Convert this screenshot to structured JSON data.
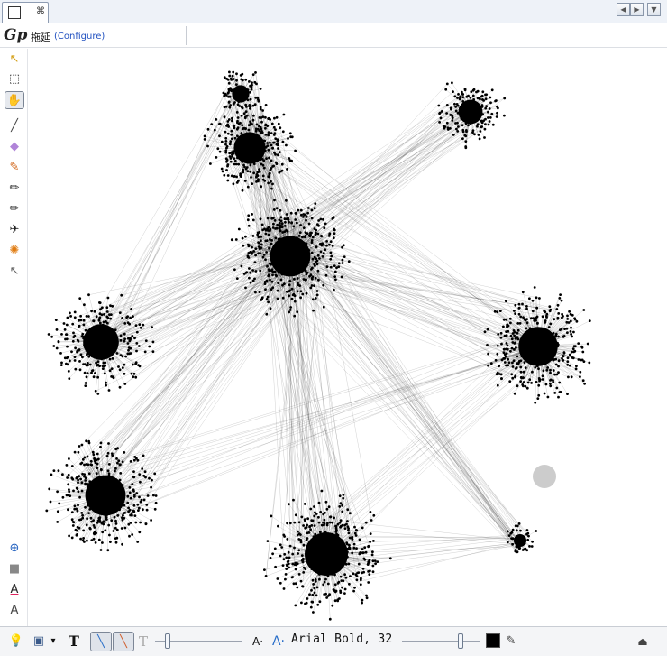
{
  "tab": {
    "close_glyph": "⌘"
  },
  "tab_nav": {
    "left": "◀",
    "right": "▶",
    "menu": "▼"
  },
  "context_bar": {
    "logo_text": "Gp",
    "tool_label": "拖延",
    "configure_link": "(Configure)"
  },
  "left_toolbar": [
    {
      "name": "pointer-icon",
      "glyph": "↖",
      "selected": false,
      "color": "#d4a017"
    },
    {
      "name": "rect-select-icon",
      "glyph": "⬚",
      "selected": false,
      "color": "#333333"
    },
    {
      "name": "drag-hand-icon",
      "glyph": "✋",
      "selected": true,
      "color": "#d4a017"
    },
    {
      "name": "brush-icon",
      "glyph": "╱",
      "selected": false,
      "color": "#444444"
    },
    {
      "name": "diamond-icon",
      "glyph": "◆",
      "selected": false,
      "color": "#b084d8"
    },
    {
      "name": "painter-icon",
      "glyph": "✎",
      "selected": false,
      "color": "#d2691e"
    },
    {
      "name": "pencil-icon",
      "glyph": "✏",
      "selected": false,
      "color": "#333333"
    },
    {
      "name": "pencil-alt-icon",
      "glyph": "✏",
      "selected": false,
      "color": "#333333"
    },
    {
      "name": "airplane-icon",
      "glyph": "✈",
      "selected": false,
      "color": "#222222"
    },
    {
      "name": "gear-icon",
      "glyph": "✺",
      "selected": false,
      "color": "#e07b10"
    },
    {
      "name": "help-pointer-icon",
      "glyph": "↖",
      "selected": false,
      "color": "#666666"
    }
  ],
  "left_toolbar_bottom": [
    {
      "name": "zoom-fit-icon",
      "glyph": "⊕",
      "color": "#1f5fbf"
    },
    {
      "name": "background-color-icon",
      "glyph": "■",
      "color": "#888888"
    },
    {
      "name": "label-color-icon",
      "glyph": "A",
      "color": "#222222"
    },
    {
      "name": "label-size-icon",
      "glyph": "A",
      "color": "#444444"
    }
  ],
  "bottom_toolbar": {
    "lightbulb_glyph": "💡",
    "screenshot_glyph": "▣",
    "dropdown_glyph": "▾",
    "text_glyph": "T",
    "edge_glyph": "╲",
    "edge_color_glyph": "╲",
    "text_alt_glyph": "T",
    "font_decrease": "A·",
    "font_increase": "A·",
    "font_label": "Arial Bold, 32",
    "label_size_level": 0.15,
    "font_size_level": 0.75,
    "text_color": "#000000",
    "edit_glyph": "✎",
    "eject_glyph": "⏏"
  },
  "graph": {
    "node_color": "#000000",
    "edge_color": "#000000",
    "cursor_color": "#cccccc"
  }
}
